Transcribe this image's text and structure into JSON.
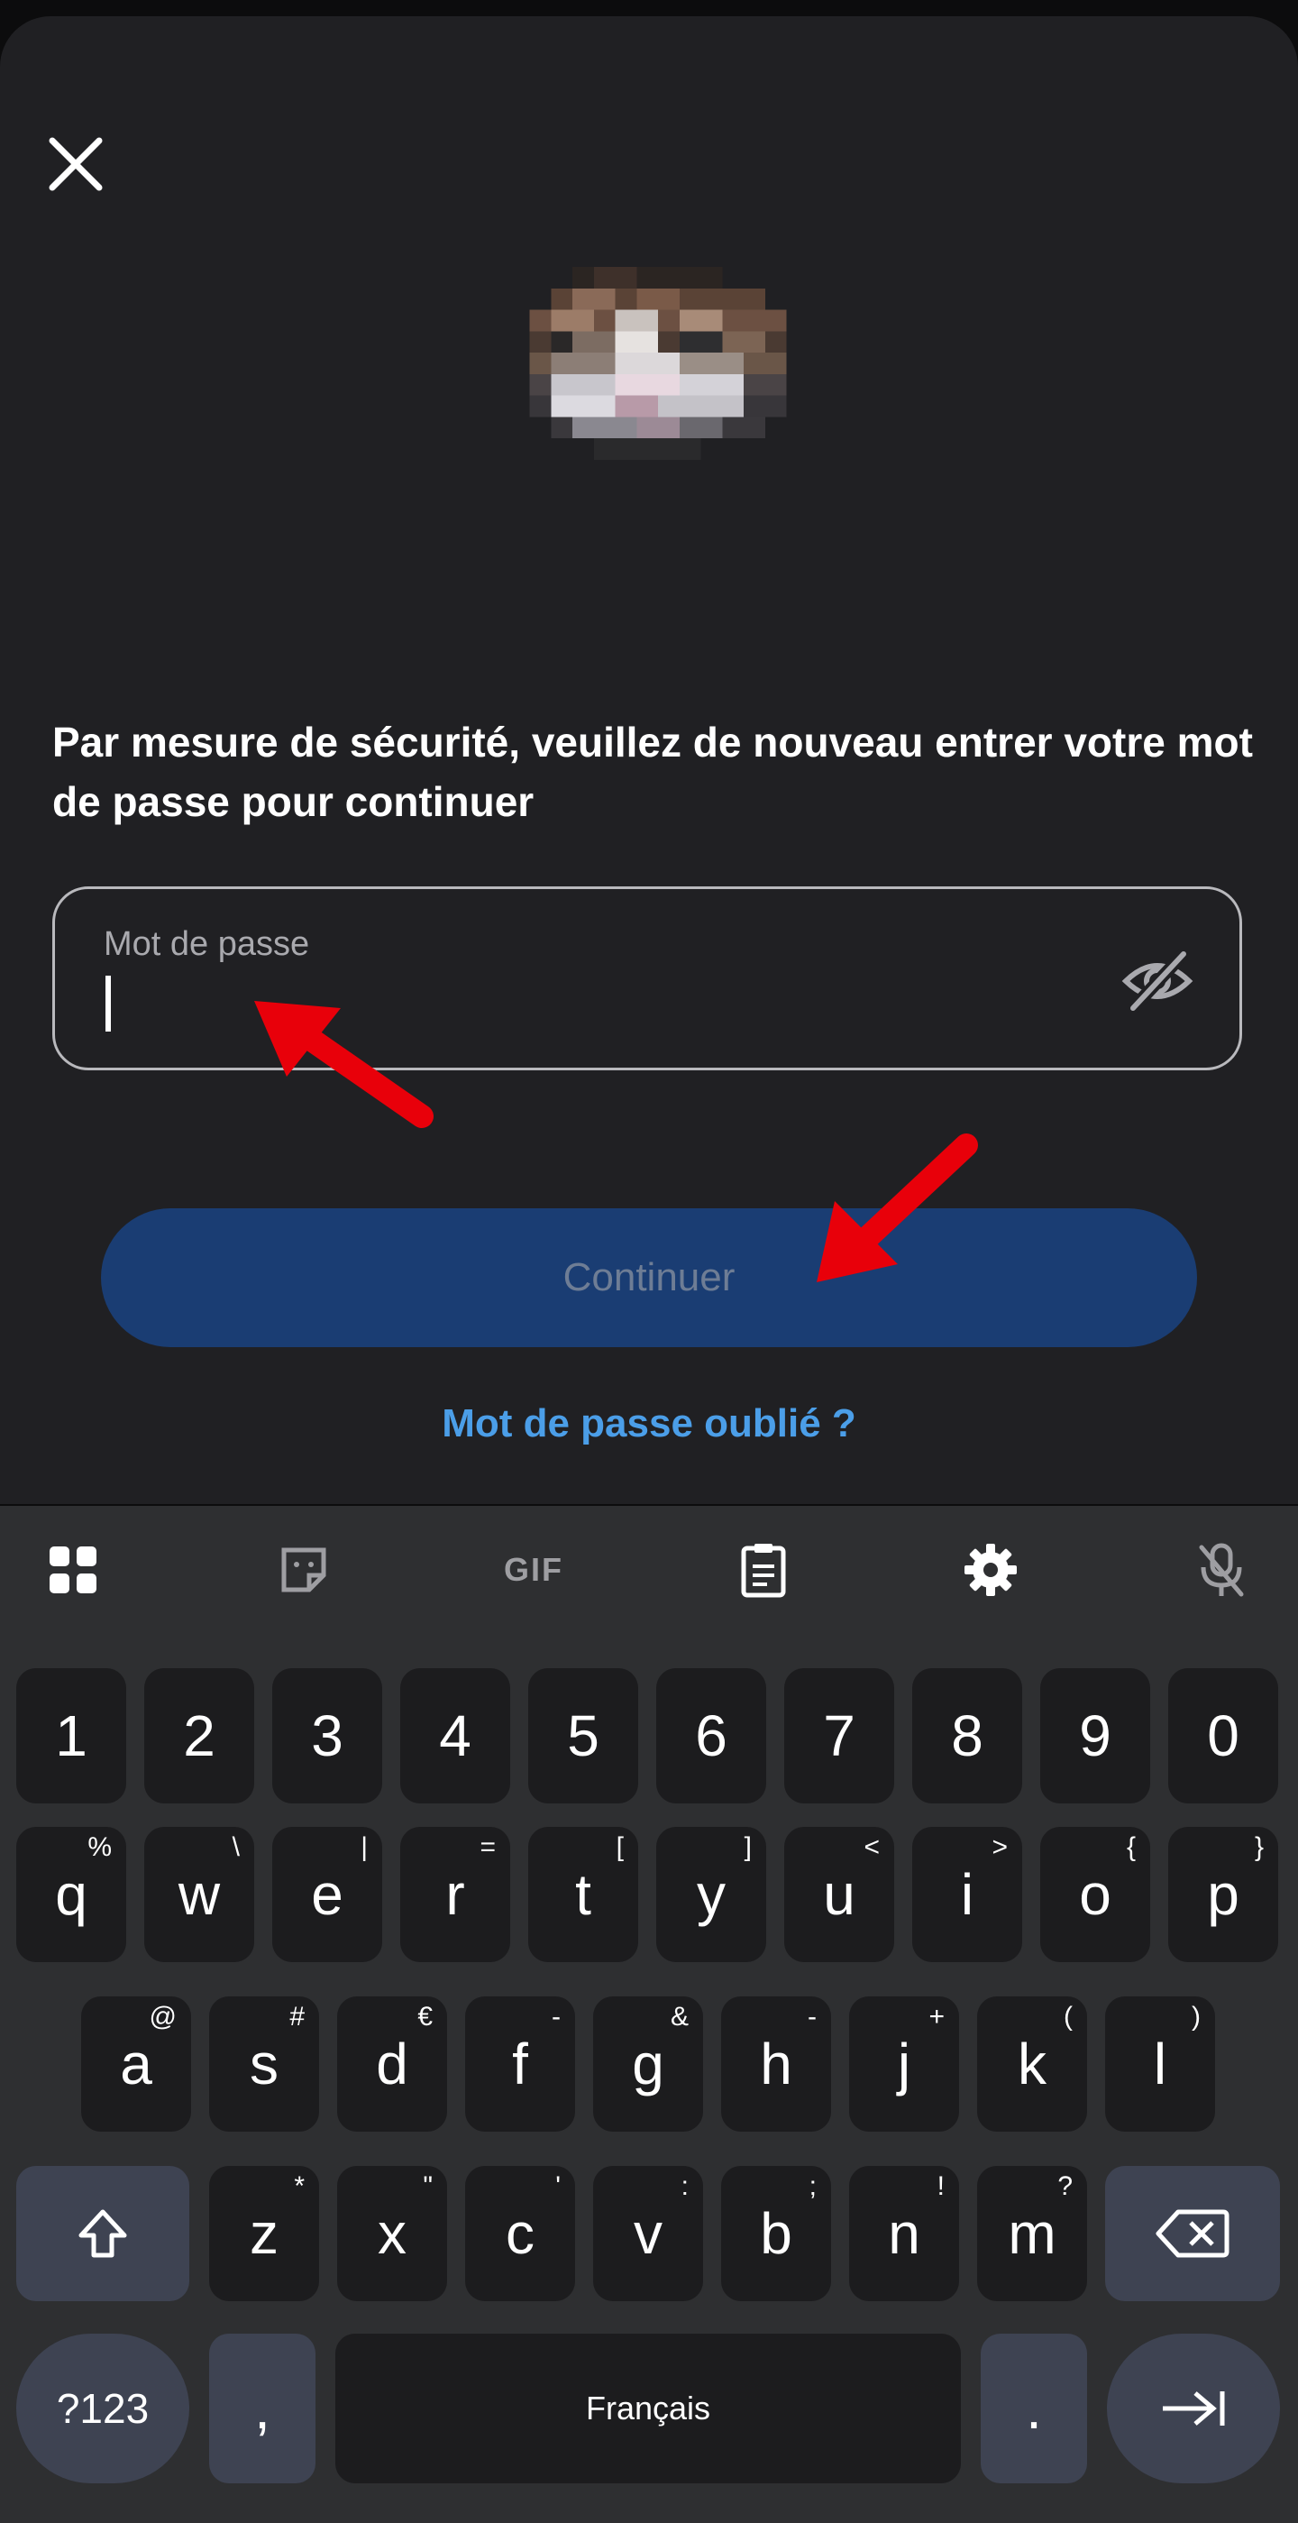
{
  "dialog": {
    "security_message": "Par mesure de sécurité, veuillez de nouveau entrer votre mot de passe pour continuer",
    "password_label": "Mot de passe",
    "password_value": "",
    "continue_label": "Continuer",
    "forgot_label": "Mot de passe oublié ?"
  },
  "colors": {
    "accent": "#1a3d73",
    "link": "#4b9ee8",
    "annotation": "#e8000a"
  },
  "keyboard": {
    "toolbar": [
      "apps-grid-icon",
      "sticker-icon",
      "GIF",
      "clipboard-icon",
      "settings-gear-icon",
      "mic-off-icon"
    ],
    "gif_label": "GIF",
    "numbers": [
      "1",
      "2",
      "3",
      "4",
      "5",
      "6",
      "7",
      "8",
      "9",
      "0"
    ],
    "row1": [
      {
        "k": "q",
        "s": "%"
      },
      {
        "k": "w",
        "s": "\\"
      },
      {
        "k": "e",
        "s": "|"
      },
      {
        "k": "r",
        "s": "="
      },
      {
        "k": "t",
        "s": "["
      },
      {
        "k": "y",
        "s": "]"
      },
      {
        "k": "u",
        "s": "<"
      },
      {
        "k": "i",
        "s": ">"
      },
      {
        "k": "o",
        "s": "{"
      },
      {
        "k": "p",
        "s": "}"
      }
    ],
    "row2": [
      {
        "k": "a",
        "s": "@"
      },
      {
        "k": "s",
        "s": "#"
      },
      {
        "k": "d",
        "s": "€"
      },
      {
        "k": "f",
        "s": "-"
      },
      {
        "k": "g",
        "s": "&"
      },
      {
        "k": "h",
        "s": "-"
      },
      {
        "k": "j",
        "s": "+"
      },
      {
        "k": "k",
        "s": "("
      },
      {
        "k": "l",
        "s": ")"
      }
    ],
    "row3": [
      {
        "k": "z",
        "s": "*"
      },
      {
        "k": "x",
        "s": "\""
      },
      {
        "k": "c",
        "s": "'"
      },
      {
        "k": "v",
        "s": ":"
      },
      {
        "k": "b",
        "s": ";"
      },
      {
        "k": "n",
        "s": "!"
      },
      {
        "k": "m",
        "s": "?"
      }
    ],
    "symbols_label": "?123",
    "comma_label": ",",
    "space_label": "Français",
    "period_label": "."
  }
}
